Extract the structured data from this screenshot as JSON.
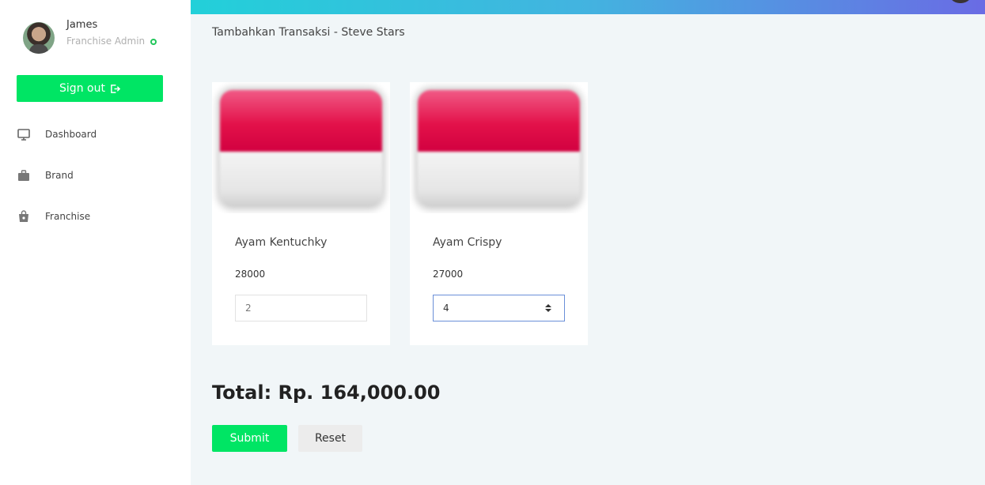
{
  "user": {
    "name": "James",
    "role": "Franchise Admin",
    "status": "online"
  },
  "sidebar": {
    "signout_label": "Sign out",
    "items": [
      {
        "label": "Dashboard",
        "icon": "monitor-icon"
      },
      {
        "label": "Brand",
        "icon": "briefcase-icon"
      },
      {
        "label": "Franchise",
        "icon": "shopping-bag-icon"
      }
    ]
  },
  "main": {
    "title": "Tambahkan Transaksi - Steve Stars",
    "products": [
      {
        "name": "Ayam Kentuchky",
        "price": "28000",
        "quantity": "2",
        "image": "indonesia-flag"
      },
      {
        "name": "Ayam Crispy",
        "price": "27000",
        "quantity": "4",
        "image": "indonesia-flag"
      }
    ],
    "total": "Total: Rp. 164,000.00",
    "submit_label": "Submit",
    "reset_label": "Reset"
  },
  "colors": {
    "accent_green": "#00e564",
    "topbar_gradient": [
      "#22d0d9",
      "#6a6be4"
    ],
    "status_online": "#21c65a"
  }
}
